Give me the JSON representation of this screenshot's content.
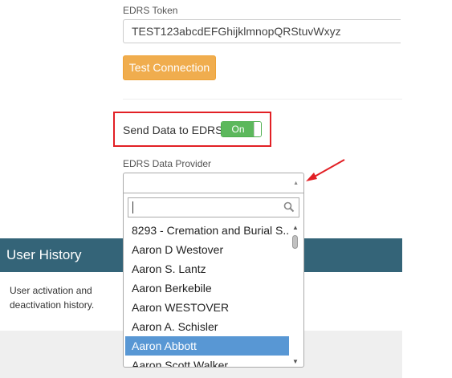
{
  "token": {
    "label": "EDRS Token",
    "value": "TEST123abcdEFGhijklmnopQRStuvWxyz"
  },
  "test_button": {
    "label": "Test Connection"
  },
  "send_data": {
    "label": "Send Data to EDRS",
    "toggle_label": "On"
  },
  "provider": {
    "label": "EDRS Data Provider",
    "selected_value": "",
    "search_value": "",
    "options": [
      "8293 - Cremation and Burial S...",
      "Aaron D Westover",
      "Aaron S. Lantz",
      "Aaron Berkebile",
      "Aaron WESTOVER",
      "Aaron A. Schisler",
      "Aaron Abbott",
      "Aaron Scott Walker"
    ],
    "highlighted_option": "Aaron Abbott"
  },
  "user_history": {
    "title": "User History",
    "description": "User activation and deactivation history."
  },
  "colors": {
    "warning_button": "#f0ad4e",
    "toggle_on": "#5cb85c",
    "section_header": "#346478",
    "option_highlight": "#5897d4",
    "annotation": "#e22025"
  }
}
